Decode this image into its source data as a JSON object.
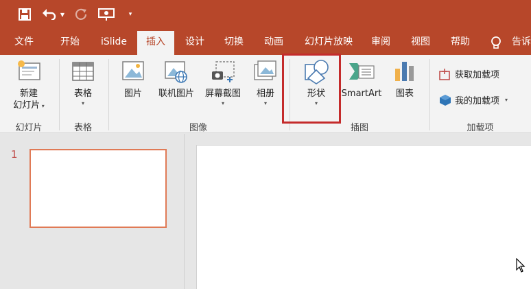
{
  "tabs": [
    {
      "label": "文件"
    },
    {
      "label": "开始"
    },
    {
      "label": "iSlide"
    },
    {
      "label": "插入",
      "active": true
    },
    {
      "label": "设计"
    },
    {
      "label": "切换"
    },
    {
      "label": "动画"
    },
    {
      "label": "幻灯片放映"
    },
    {
      "label": "审阅"
    },
    {
      "label": "视图"
    },
    {
      "label": "帮助"
    },
    {
      "label": "告诉"
    }
  ],
  "ribbon": {
    "slides": {
      "label_line1": "新建",
      "label_line2": "幻灯片",
      "group": "幻灯片"
    },
    "tables": {
      "label": "表格",
      "group": "表格"
    },
    "images": {
      "picture": "图片",
      "online_picture": "联机图片",
      "screenshot": "屏幕截图",
      "album": "相册",
      "group": "图像"
    },
    "illustrations": {
      "shapes": "形状",
      "smartart": "SmartArt",
      "chart": "图表",
      "group": "插图"
    },
    "addins": {
      "get_addins": "获取加载项",
      "my_addins": "我的加载项",
      "group": "加载项"
    }
  },
  "slides_panel": {
    "thumb_number": "1"
  },
  "colors": {
    "accent": "#b7472a",
    "highlight_box": "#c42b2b",
    "thumb_border": "#e07a56"
  }
}
